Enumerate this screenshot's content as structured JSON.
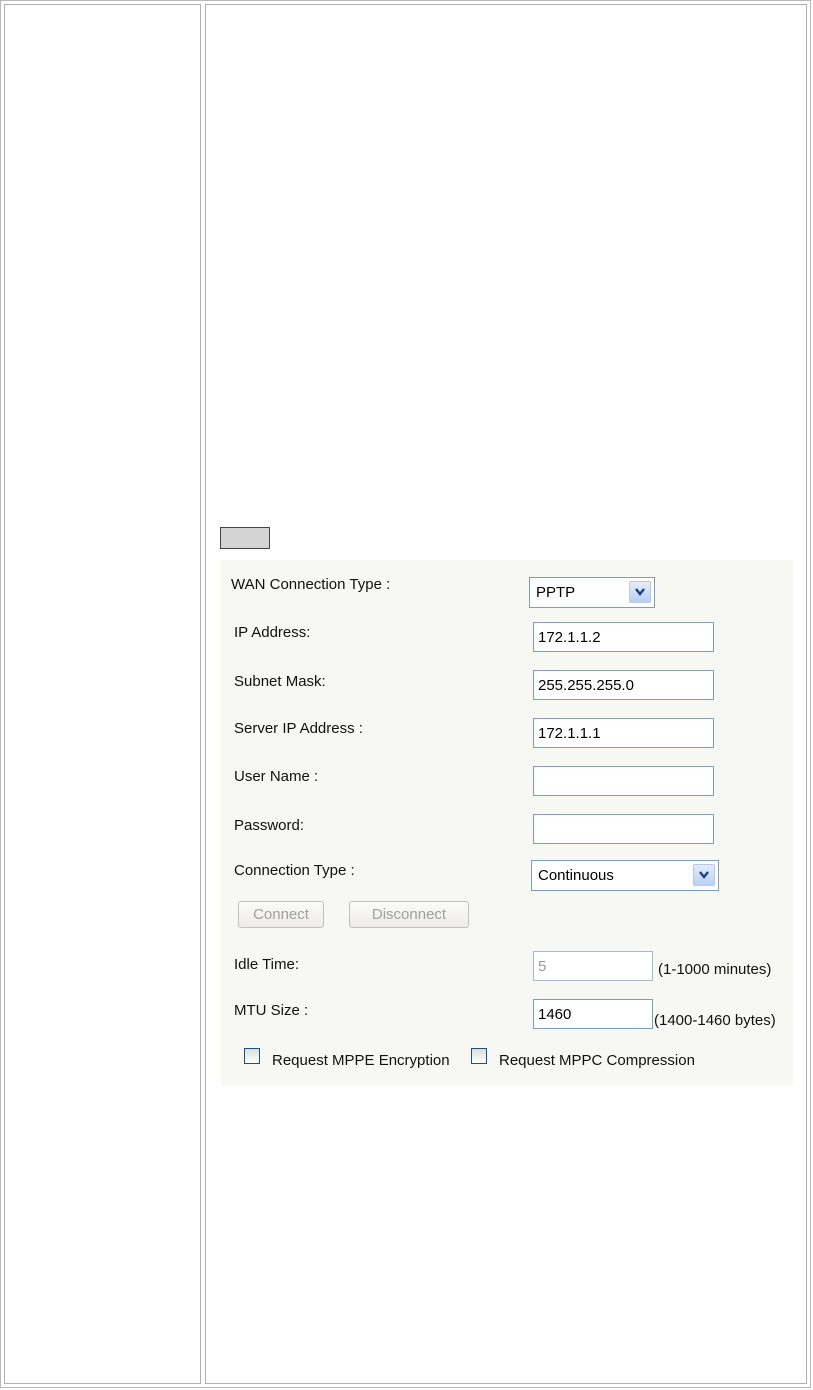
{
  "form": {
    "wan_connection_type": {
      "label": "WAN Connection Type :",
      "value": "PPTP"
    },
    "ip_address": {
      "label": "IP Address:",
      "value": "172.1.1.2"
    },
    "subnet_mask": {
      "label": "Subnet Mask:",
      "value": "255.255.255.0"
    },
    "server_ip_address": {
      "label": "Server IP Address :",
      "value": "172.1.1.1"
    },
    "user_name": {
      "label": "User Name :",
      "value": ""
    },
    "password": {
      "label": "Password:",
      "value": ""
    },
    "connection_type": {
      "label": "Connection Type :",
      "value": "Continuous"
    },
    "connect_button": "Connect",
    "disconnect_button": "Disconnect",
    "idle_time": {
      "label": "Idle Time:",
      "value": "5",
      "hint": "(1-1000 minutes)",
      "disabled": true
    },
    "mtu_size": {
      "label": "MTU Size :",
      "value": "1460",
      "hint": "(1400-1460 bytes)"
    },
    "mppe_encryption": {
      "label": "Request MPPE Encryption",
      "checked": false
    },
    "mppc_compression": {
      "label": "Request MPPC Compression",
      "checked": false
    }
  },
  "icons": {
    "dropdown": "chevron-down-icon"
  },
  "colors": {
    "panel_bg": "#f7f7f4",
    "field_border": "#7f9db9",
    "disabled_text": "#a0a0a0"
  }
}
